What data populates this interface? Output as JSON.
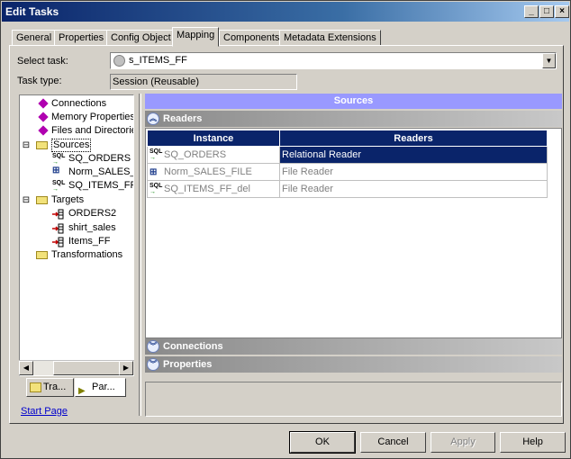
{
  "window": {
    "title": "Edit Tasks"
  },
  "title_buttons": {
    "minimize": "_",
    "maximize": "□",
    "close": "×"
  },
  "tabs": [
    {
      "label": "General"
    },
    {
      "label": "Properties"
    },
    {
      "label": "Config Object"
    },
    {
      "label": "Mapping",
      "active": true
    },
    {
      "label": "Components"
    },
    {
      "label": "Metadata Extensions"
    }
  ],
  "form": {
    "select_task_label": "Select task:",
    "select_task_value": "s_ITEMS_FF",
    "task_type_label": "Task type:",
    "task_type_value": "Session (Reusable)"
  },
  "tree": {
    "connections": "Connections",
    "memory_properties": "Memory Properties",
    "files_and_directories": "Files and Directories",
    "sources": "Sources",
    "sources_children": [
      "SQ_ORDERS",
      "Norm_SALES_F",
      "SQ_ITEMS_FF_"
    ],
    "targets": "Targets",
    "targets_children": [
      "ORDERS2",
      "shirt_sales",
      "Items_FF"
    ],
    "transformations": "Transformations",
    "expander_minus": "⊟"
  },
  "bottom_tabs": {
    "tra": "Tra...",
    "par": "Par..."
  },
  "start_page_link": "Start Page",
  "right_panel": {
    "sources_header": "Sources",
    "readers_section": "Readers",
    "connections_section": "Connections",
    "properties_section": "Properties",
    "columns": {
      "instance": "Instance",
      "readers": "Readers"
    },
    "rows": [
      {
        "icon": "SQL",
        "instance": "SQ_ORDERS",
        "reader": "Relational Reader",
        "selected": true
      },
      {
        "icon": "norm",
        "instance": "Norm_SALES_FILE",
        "reader": "File Reader",
        "selected": false
      },
      {
        "icon": "SQL",
        "instance": "SQ_ITEMS_FF_del",
        "reader": "File Reader",
        "selected": false
      }
    ]
  },
  "buttons": {
    "ok": "OK",
    "cancel": "Cancel",
    "apply": "Apply",
    "help": "Help"
  },
  "colors": {
    "title_gradient_start": "#0a246a",
    "sources_header": "#9999ff",
    "selected_row": "#0a246a"
  }
}
